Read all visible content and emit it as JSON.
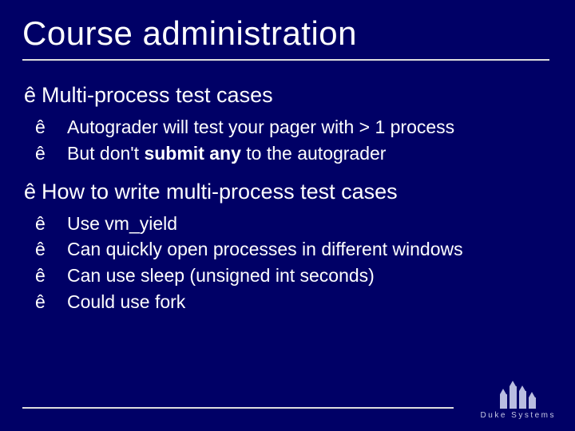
{
  "title": "Course administration",
  "section1": {
    "heading": "Multi-process test cases",
    "items": [
      "Autograder will test your pager with > 1 process",
      "But don't ",
      " to the autograder"
    ],
    "bold": "submit any"
  },
  "section2": {
    "heading": "How to write multi-process test cases",
    "items": [
      "Use vm_yield",
      "Can quickly open processes in different windows",
      "Can use sleep (unsigned int seconds)",
      "Could use fork"
    ]
  },
  "bullet": "ê",
  "logo": "Duke Systems"
}
